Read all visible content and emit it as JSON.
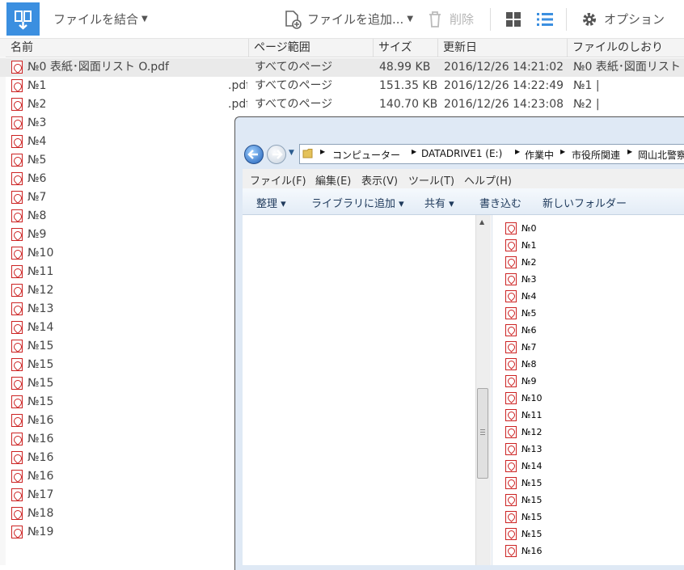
{
  "toolbar": {
    "merge_label": "ファイルを結合",
    "add_label": "ファイルを追加...",
    "delete_label": "削除",
    "options_label": "オプション"
  },
  "columns": [
    "名前",
    "ページ範囲",
    "サイズ",
    "更新日",
    "ファイルのしおり"
  ],
  "rows": [
    {
      "name": "№0 表紙･図面リスト O.pdf",
      "range": "すべてのページ",
      "size": "48.99 KB",
      "date": "2016/12/26 14:21:02",
      "bookmark": "№0 表紙･図面リスト"
    },
    {
      "name": "№1",
      "suffix": ".pdf",
      "range": "すべてのページ",
      "size": "151.35 KB",
      "date": "2016/12/26 14:22:49",
      "bookmark": "№1 |"
    },
    {
      "name": "№2",
      "suffix": ".pdf",
      "range": "すべてのページ",
      "size": "140.70 KB",
      "date": "2016/12/26 14:23:08",
      "bookmark": "№2 |"
    },
    {
      "name": "№3"
    },
    {
      "name": "№4"
    },
    {
      "name": "№5"
    },
    {
      "name": "№6"
    },
    {
      "name": "№7"
    },
    {
      "name": "№8"
    },
    {
      "name": "№9"
    },
    {
      "name": "№10"
    },
    {
      "name": "№11"
    },
    {
      "name": "№12"
    },
    {
      "name": "№13"
    },
    {
      "name": "№14"
    },
    {
      "name": "№15"
    },
    {
      "name": "№15"
    },
    {
      "name": "№15"
    },
    {
      "name": "№15"
    },
    {
      "name": "№16"
    },
    {
      "name": "№16"
    },
    {
      "name": "№16"
    },
    {
      "name": "№16"
    },
    {
      "name": "№17"
    },
    {
      "name": "№18"
    },
    {
      "name": "№19"
    }
  ],
  "explorer": {
    "path": [
      "コンピューター",
      "DATADRIVE1 (E:)",
      "作業中",
      "市役所関連",
      "岡山北警察"
    ],
    "menu": [
      "ファイル(F)",
      "編集(E)",
      "表示(V)",
      "ツール(T)",
      "ヘルプ(H)"
    ],
    "commands": [
      "整理 ▾",
      "ライブラリに追加 ▾",
      "共有 ▾",
      "書き込む",
      "新しいフォルダー"
    ],
    "files": [
      "№0",
      "№1",
      "№2",
      "№3",
      "№4",
      "№5",
      "№6",
      "№7",
      "№8",
      "№9",
      "№10",
      "№11",
      "№12",
      "№13",
      "№14",
      "№15",
      "№15",
      "№15",
      "№15",
      "№16"
    ]
  },
  "colors": {
    "accent": "#3b8fe0",
    "pdf_red": "#cc2222",
    "selected_row": "#eaeaea"
  }
}
